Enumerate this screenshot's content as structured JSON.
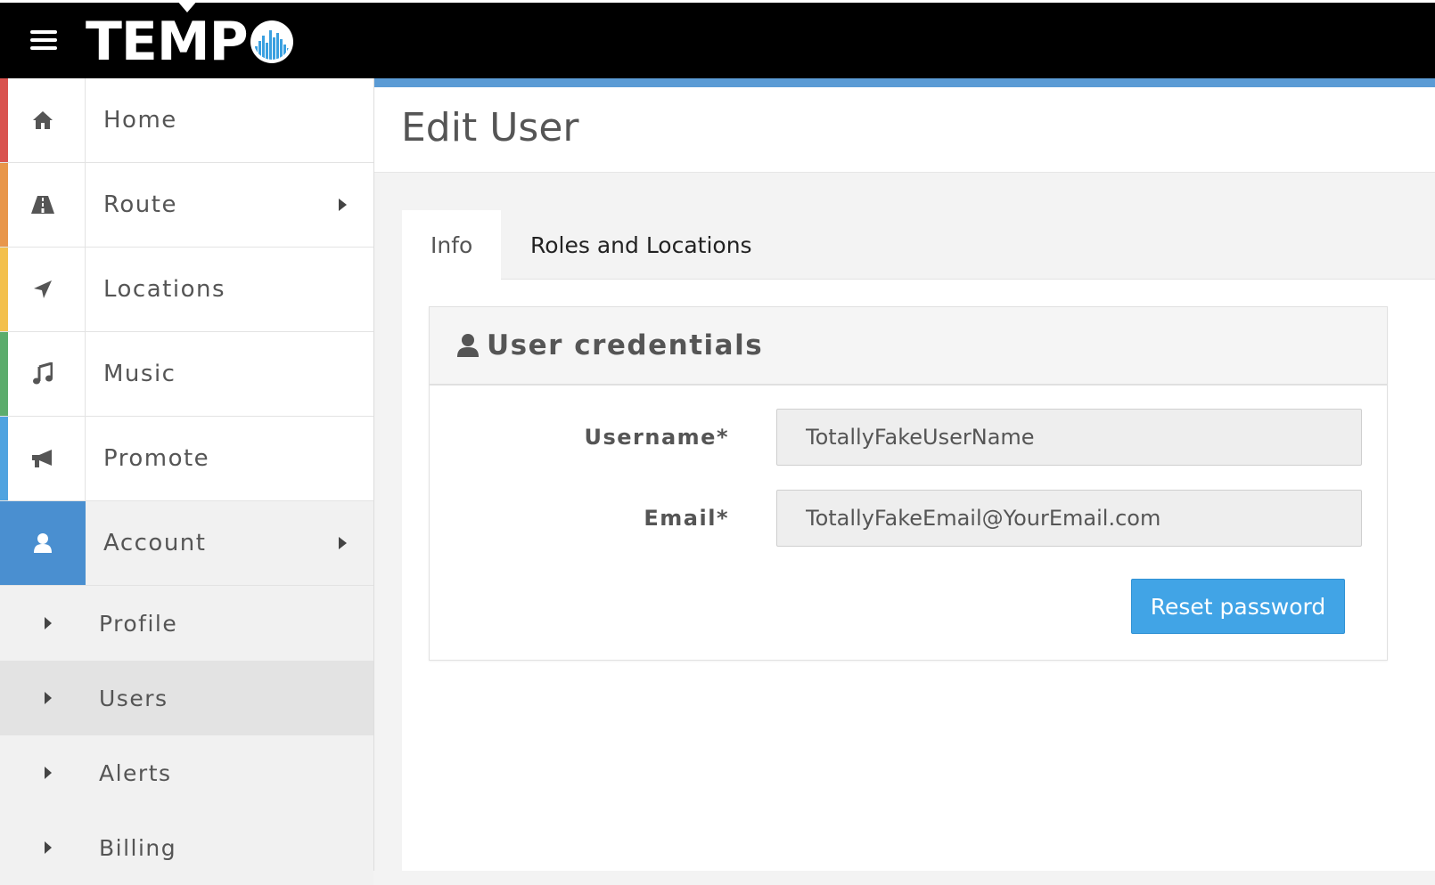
{
  "header": {
    "logo_text": "TEMP",
    "logo_icon": "equalizer-circle-icon",
    "menu_icon": "hamburger-icon"
  },
  "sidebar": {
    "items": [
      {
        "label": "Home",
        "icon": "home-icon",
        "stripe_color": "#d9534f",
        "has_caret": false
      },
      {
        "label": "Route",
        "icon": "road-icon",
        "stripe_color": "#e8964a",
        "has_caret": true
      },
      {
        "label": "Locations",
        "icon": "location-arrow-icon",
        "stripe_color": "#f3c04c",
        "has_caret": false
      },
      {
        "label": "Music",
        "icon": "music-icon",
        "stripe_color": "#5cac6c",
        "has_caret": false
      },
      {
        "label": "Promote",
        "icon": "bullhorn-icon",
        "stripe_color": "#4fa3e0",
        "has_caret": false
      },
      {
        "label": "Account",
        "icon": "user-icon",
        "stripe_color": "#4a8fd0",
        "has_caret": true,
        "active": true
      }
    ],
    "sub_items": [
      {
        "label": "Profile",
        "selected": false
      },
      {
        "label": "Users",
        "selected": true
      },
      {
        "label": "Alerts",
        "selected": false
      },
      {
        "label": "Billing",
        "selected": false
      }
    ]
  },
  "main": {
    "page_title": "Edit User",
    "tabs": [
      {
        "label": "Info",
        "active": true
      },
      {
        "label": "Roles and Locations",
        "active": false
      }
    ],
    "card": {
      "title": "User credentials",
      "icon": "user-icon",
      "fields": [
        {
          "label": "Username*",
          "value": "TotallyFakeUserName"
        },
        {
          "label": "Email*",
          "value": "TotallyFakeEmail@YourEmail.com"
        }
      ],
      "reset_button_label": "Reset password"
    }
  },
  "colors": {
    "accent": "#5b9bd5",
    "button": "#41a4e6",
    "active_nav": "#4a8fd0"
  }
}
